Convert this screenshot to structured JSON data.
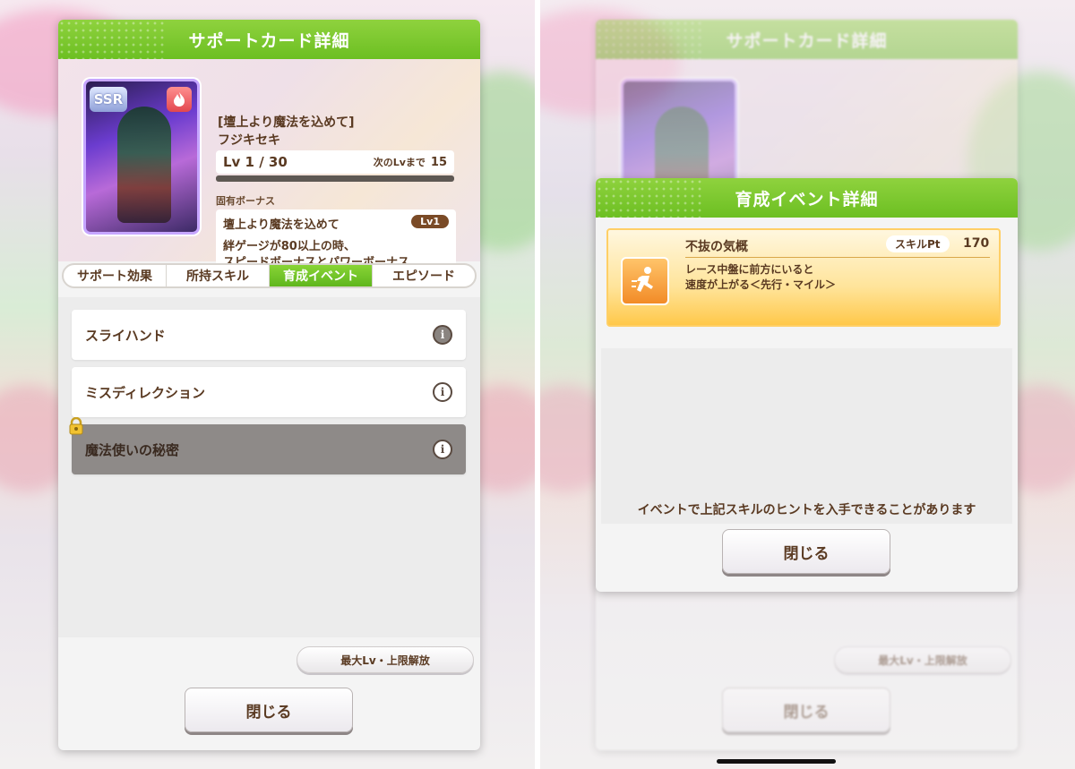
{
  "left": {
    "dialog_title": "サポートカード詳細",
    "card": {
      "rarity": "SSR",
      "type_icon": "fire-icon",
      "title": "[壇上より魔法を込めて]",
      "name": "フジキセキ",
      "level": "Lv 1 / 30",
      "next_lv_label": "次のLvまで",
      "next_lv_value": "15",
      "level_progress": 0
    },
    "bonus": {
      "label": "固有ボーナス",
      "title": "壇上より魔法を込めて",
      "level": "Lv1",
      "description": "絆ゲージが80以上の時、\nスピードボーナスとパワーボーナス"
    },
    "tabs": [
      {
        "label": "サポート効果",
        "active": false
      },
      {
        "label": "所持スキル",
        "active": false
      },
      {
        "label": "育成イベント",
        "active": true
      },
      {
        "label": "エピソード",
        "active": false
      }
    ],
    "events": [
      {
        "name": "スライハンド",
        "locked": false
      },
      {
        "name": "ミスディレクション",
        "locked": false
      },
      {
        "name": "魔法使いの秘密",
        "locked": true
      }
    ],
    "max_lv_button": "最大Lv・上限解放",
    "close_button": "閉じる"
  },
  "right": {
    "dialog_title": "育成イベント詳細",
    "skill": {
      "name": "不抜の気概",
      "pt_label": "スキルPt",
      "pt_value": "170",
      "description": "レース中盤に前方にいると\n速度が上がる＜先行・マイル＞",
      "icon": "running-figure-icon"
    },
    "hint": "イベントで上記スキルのヒントを入手できることがあります",
    "close_button": "閉じる"
  },
  "colors": {
    "header_green": "#6cbf22",
    "text_brown": "#5a3a22",
    "skill_gold": "#ffc84a"
  }
}
